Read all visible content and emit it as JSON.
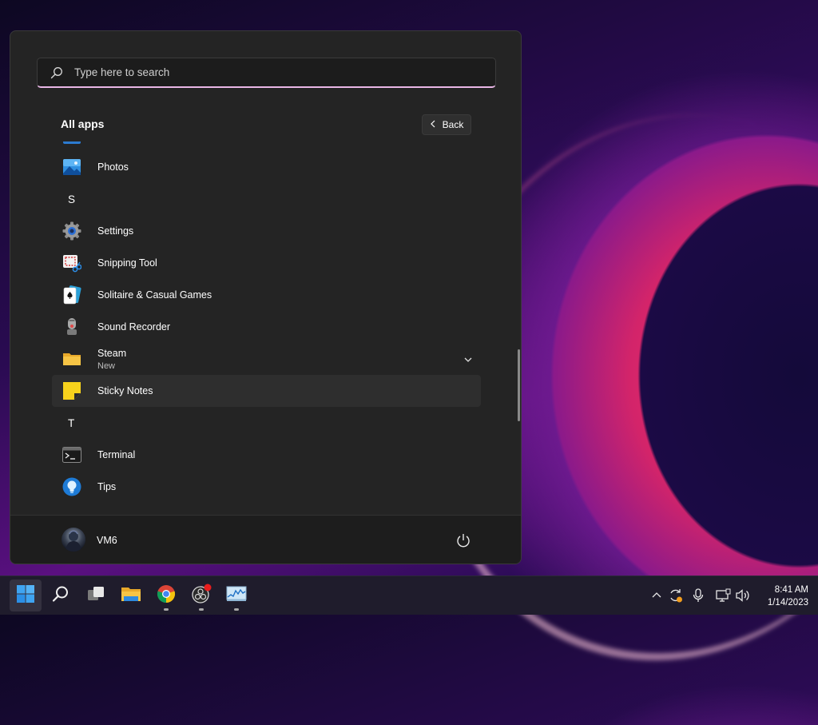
{
  "search": {
    "placeholder": "Type here to search"
  },
  "header": {
    "title": "All apps",
    "back_label": "Back"
  },
  "apps": [
    {
      "label": "Photos",
      "icon": "photos-icon"
    },
    {
      "letter": "S"
    },
    {
      "label": "Settings",
      "icon": "settings-gear-icon"
    },
    {
      "label": "Snipping Tool",
      "icon": "snipping-tool-icon"
    },
    {
      "label": "Solitaire & Casual Games",
      "icon": "solitaire-icon"
    },
    {
      "label": "Sound Recorder",
      "icon": "microphone-icon"
    },
    {
      "label": "Steam",
      "sublabel": "New",
      "icon": "folder-icon"
    },
    {
      "label": "Sticky Notes",
      "icon": "sticky-notes-icon"
    },
    {
      "letter": "T"
    },
    {
      "label": "Terminal",
      "icon": "terminal-icon"
    },
    {
      "label": "Tips",
      "icon": "tips-bulb-icon"
    }
  ],
  "footer": {
    "user_name": "VM6"
  },
  "taskbar": {
    "apps": [
      "start-icon",
      "search-icon",
      "task-view-icon",
      "file-explorer-icon",
      "chrome-icon",
      "obs-icon",
      "resource-monitor-icon"
    ],
    "clock": {
      "time": "8:41 AM",
      "date": "1/14/2023"
    }
  },
  "colors": {
    "accent": "#e9b7e6",
    "menu_bg": "#242424",
    "taskbar_bg": "#1f1c2c"
  }
}
